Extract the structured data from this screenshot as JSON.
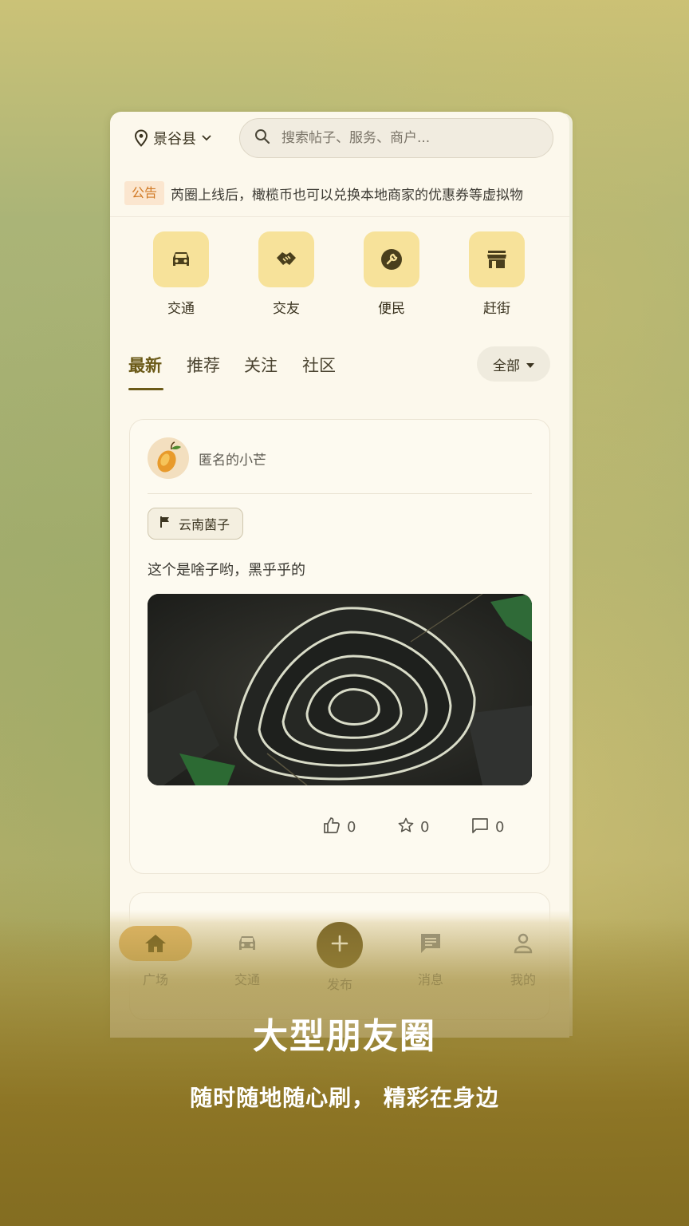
{
  "header": {
    "location": "景谷县",
    "search_placeholder": "搜索帖子、服务、商户..."
  },
  "notice": {
    "badge": "公告",
    "text": "芮圈上线后，橄榄币也可以兑换本地商家的优惠券等虚拟物"
  },
  "quick_links": [
    {
      "label": "交通",
      "icon": "car-icon"
    },
    {
      "label": "交友",
      "icon": "handshake-icon"
    },
    {
      "label": "便民",
      "icon": "wrench-icon"
    },
    {
      "label": "赶街",
      "icon": "store-icon"
    }
  ],
  "tabs": [
    {
      "label": "最新",
      "active": true
    },
    {
      "label": "推荐",
      "active": false
    },
    {
      "label": "关注",
      "active": false
    },
    {
      "label": "社区",
      "active": false
    }
  ],
  "filter": {
    "label": "全部"
  },
  "post": {
    "author": "匿名的小芒",
    "tag": "云南菌子",
    "text": "这个是啥子哟，黑乎乎的",
    "likes": "0",
    "favorites": "0",
    "comments": "0"
  },
  "bottom_nav": [
    {
      "label": "广场",
      "icon": "home-icon",
      "active": true
    },
    {
      "label": "交通",
      "icon": "car-icon",
      "active": false
    },
    {
      "label": "发布",
      "icon": "plus-icon",
      "active": false
    },
    {
      "label": "消息",
      "icon": "message-icon",
      "active": false
    },
    {
      "label": "我的",
      "icon": "person-icon",
      "active": false
    }
  ],
  "promo": {
    "title": "大型朋友圈",
    "subtitle": "随时随地随心刷，   精彩在身边"
  },
  "colors": {
    "accent": "#6b5a18",
    "quick_icon_bg": "#f7e29a",
    "notice_badge": "#d17a25",
    "nav_active": "#ddb463"
  }
}
